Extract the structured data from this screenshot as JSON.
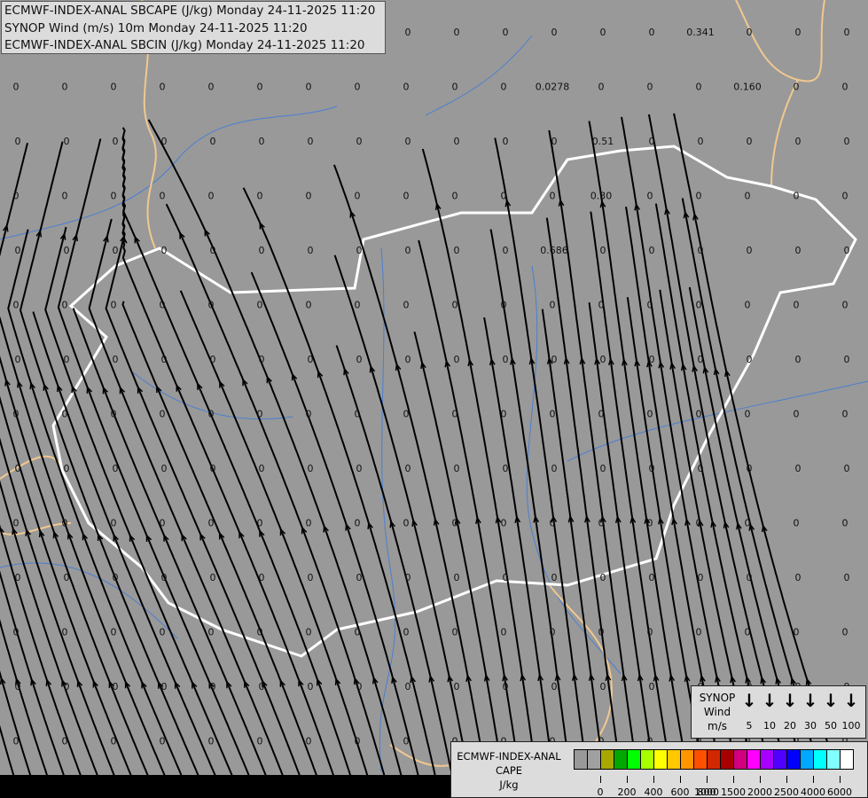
{
  "title_box": {
    "lines": [
      "ECMWF-INDEX-ANAL SBCAPE (J/kg) Monday 24-11-2025 11:20",
      "SYNOP Wind (m/s) 10m Monday 24-11-2025 11:20",
      "ECMWF-INDEX-ANAL SBCIN (J/kg) Monday 24-11-2025 11:20"
    ]
  },
  "map": {
    "background_color": "#999999",
    "country_border_color": "#ffffff",
    "neighbour_border_color": "#f0c890",
    "river_color": "#4a7fd0",
    "streamline_color": "#000000",
    "sbcin_default_value": "0",
    "sbcin_nonzero_values": [
      "0.341",
      "0.160",
      "0.0278",
      "0.51",
      "0.30",
      "0.686"
    ]
  },
  "wind_legend": {
    "title": [
      "SYNOP",
      "Wind",
      "m/s"
    ],
    "icon": "arrow-down-icon",
    "speeds": [
      "5",
      "10",
      "20",
      "30",
      "50",
      "100"
    ]
  },
  "cape_legend": {
    "title": [
      "ECMWF-INDEX-ANAL",
      "CAPE",
      "J/kg"
    ],
    "colors": [
      "#999999",
      "#a0a0a0",
      "#a8a800",
      "#00a800",
      "#00ff00",
      "#a8ff00",
      "#ffff00",
      "#ffc800",
      "#ff9600",
      "#ff5000",
      "#d22800",
      "#a80000",
      "#d2007e",
      "#ff00ff",
      "#a800ff",
      "#5000ff",
      "#0000ff",
      "#00a8ff",
      "#00ffff",
      "#80ffff",
      "#ffffff"
    ],
    "ticks": [
      "0",
      "200",
      "400",
      "600",
      "800",
      "1000",
      "1500",
      "2000",
      "2500",
      "4000",
      "6000"
    ]
  }
}
